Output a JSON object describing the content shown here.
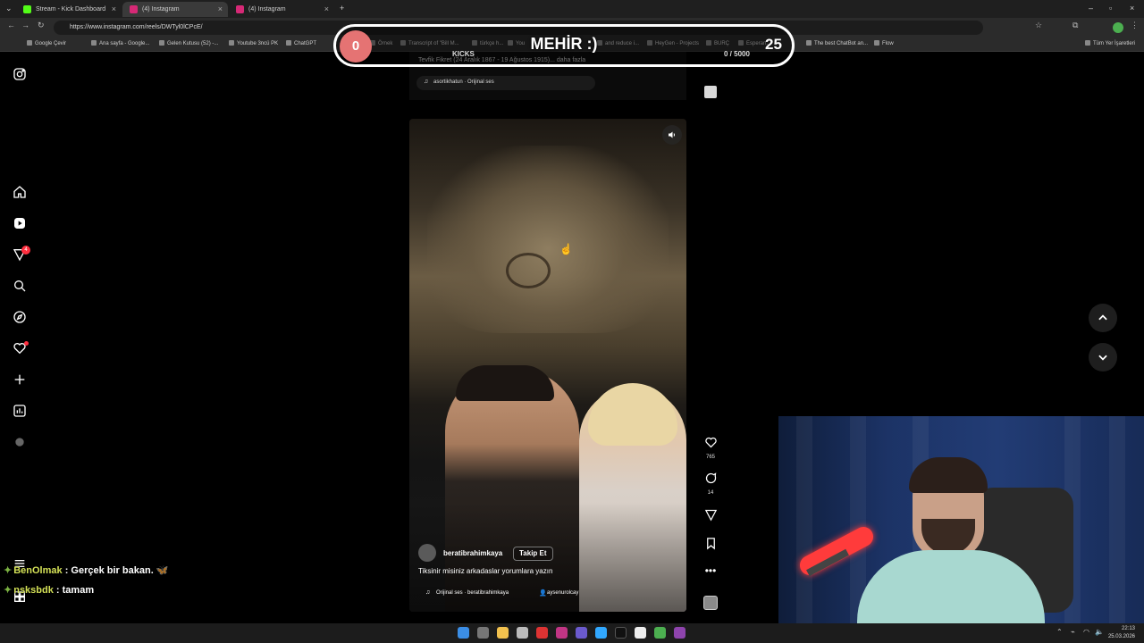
{
  "browser": {
    "tabs": [
      {
        "title": "Stream - Kick Dashboard",
        "active": false
      },
      {
        "title": "(4) Instagram",
        "active": true
      },
      {
        "title": "(4) Instagram",
        "active": false
      }
    ],
    "new_tab": "+",
    "url": "https://www.instagram.com/reels/DWTyl0lCPcE/",
    "bookmarks": [
      "Google Çevir",
      "Ana sayfa - Google...",
      "Gelen Kutusu (52) -...",
      "Youtube 3ncü PK",
      "ChatGPT",
      "Örnek",
      "Transcript of \"Bill M...",
      "türkçe h...",
      "You",
      "and reduce i...",
      "HeyGen - Projects",
      "BURÇ",
      "Esperan...",
      "The best ChatBot an...",
      "Flow"
    ],
    "all_bookmarks": "Tüm Yer İşaretleri"
  },
  "instagram": {
    "notification_count": "4",
    "prev_card": {
      "caption": "Tevfik Fikret (24 Aralık 1867 - 19 Ağustos 1915)... daha fazla",
      "audio": "asortikhatun · Orijinal ses"
    },
    "reel": {
      "username": "beratibrahimkaya",
      "follow_label": "Takip Et",
      "caption": "Tiksinir misiniz arkadaslar yorumlara yazın",
      "audio": "Orijinal ses · beratibrahimkaya",
      "tagged_user": "aysenurolcay",
      "likes": "765",
      "comments": "14"
    }
  },
  "overlay": {
    "goal_left": "0",
    "title": "MEHİR :)",
    "goal_right": "25",
    "kicks_label": "KICKS",
    "kicks_progress": "0 / 5000"
  },
  "chat": [
    {
      "nick": "BenOlmak",
      "message": ": Gerçek bir bakan. 🦋"
    },
    {
      "nick": "nsksbdk",
      "message": ": tamam"
    }
  ],
  "taskbar": {
    "time": "22:13",
    "date": "25.03.2026"
  },
  "colors": {
    "goal_badge": "#e57373",
    "notification": "#ff3040",
    "chat_nick": "#d4e157"
  }
}
